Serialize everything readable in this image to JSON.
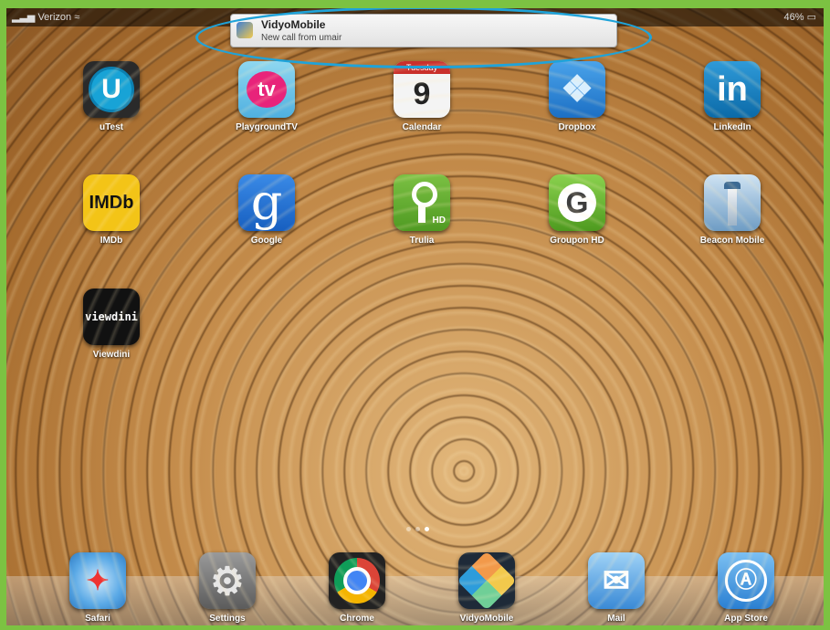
{
  "status": {
    "carrier": "Verizon",
    "battery": "46%"
  },
  "notification": {
    "title": "VidyoMobile",
    "body": "New call from umair"
  },
  "apps": [
    {
      "label": "uTest",
      "icon": "utest-icon",
      "glyph": "U"
    },
    {
      "label": "PlaygroundTV",
      "icon": "playgroundtv-icon",
      "glyph": "tv"
    },
    {
      "label": "Calendar",
      "icon": "calendar-icon",
      "day": "Tuesday",
      "date": "9"
    },
    {
      "label": "Dropbox",
      "icon": "dropbox-icon",
      "glyph": "❖"
    },
    {
      "label": "LinkedIn",
      "icon": "linkedin-icon",
      "glyph": "in"
    },
    {
      "label": "IMDb",
      "icon": "imdb-icon",
      "glyph": "IMDb"
    },
    {
      "label": "Google",
      "icon": "google-icon",
      "glyph": "g"
    },
    {
      "label": "Trulia",
      "icon": "trulia-icon",
      "glyph": "HD"
    },
    {
      "label": "Groupon HD",
      "icon": "groupon-icon",
      "glyph": "G"
    },
    {
      "label": "Beacon Mobile",
      "icon": "beacon-icon",
      "glyph": ""
    },
    {
      "label": "Viewdini",
      "icon": "viewdini-icon",
      "glyph": "viewdini"
    }
  ],
  "dock": [
    {
      "label": "Safari",
      "icon": "safari-icon"
    },
    {
      "label": "Settings",
      "icon": "settings-icon"
    },
    {
      "label": "Chrome",
      "icon": "chrome-icon"
    },
    {
      "label": "VidyoMobile",
      "icon": "vidyomobile-icon"
    },
    {
      "label": "Mail",
      "icon": "mail-icon"
    },
    {
      "label": "App Store",
      "icon": "app-store-icon"
    }
  ],
  "page_indicator": {
    "pages": 3,
    "current": 3
  }
}
